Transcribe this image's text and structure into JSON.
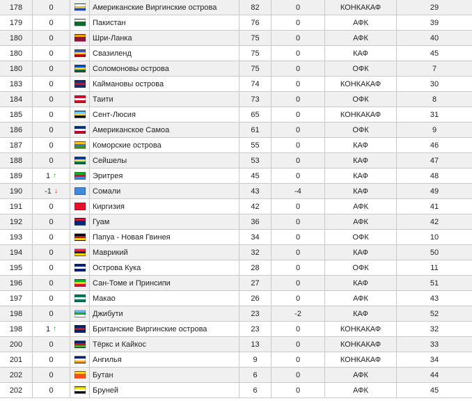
{
  "rows": [
    {
      "rank": "178",
      "change": "0",
      "arrow": "",
      "name": "Американские Виргинские острова",
      "points": "82",
      "diff": "0",
      "conf": "КОНКАКАФ",
      "conf_rank": "29",
      "flag_colors": [
        "#ffffff",
        "#d8c23a",
        "#1e4ca1"
      ]
    },
    {
      "rank": "179",
      "change": "0",
      "arrow": "",
      "name": "Пакистан",
      "points": "76",
      "diff": "0",
      "conf": "АФК",
      "conf_rank": "39",
      "flag_colors": [
        "#ffffff",
        "#0a6b2c",
        "#0a6b2c"
      ]
    },
    {
      "rank": "180",
      "change": "0",
      "arrow": "",
      "name": "Шри-Ланка",
      "points": "75",
      "diff": "0",
      "conf": "АФК",
      "conf_rank": "40",
      "flag_colors": [
        "#f4a300",
        "#8d153a",
        "#8d153a"
      ]
    },
    {
      "rank": "180",
      "change": "0",
      "arrow": "",
      "name": "Свазиленд",
      "points": "75",
      "diff": "0",
      "conf": "КАФ",
      "conf_rank": "45",
      "flag_colors": [
        "#3e5eb9",
        "#ffd900",
        "#b10c0c"
      ]
    },
    {
      "rank": "180",
      "change": "0",
      "arrow": "",
      "name": "Соломоновы острова",
      "points": "75",
      "diff": "0",
      "conf": "ОФК",
      "conf_rank": "7",
      "flag_colors": [
        "#0051ba",
        "#fcd116",
        "#215b33"
      ]
    },
    {
      "rank": "183",
      "change": "0",
      "arrow": "",
      "name": "Каймановы острова",
      "points": "74",
      "diff": "0",
      "conf": "КОНКАКАФ",
      "conf_rank": "30",
      "flag_colors": [
        "#1b2d6b",
        "#c8102e",
        "#1b2d6b"
      ]
    },
    {
      "rank": "184",
      "change": "0",
      "arrow": "",
      "name": "Таити",
      "points": "73",
      "diff": "0",
      "conf": "ОФК",
      "conf_rank": "8",
      "flag_colors": [
        "#ce1126",
        "#ffffff",
        "#ce1126"
      ]
    },
    {
      "rank": "185",
      "change": "0",
      "arrow": "",
      "name": "Сент-Люсия",
      "points": "65",
      "diff": "0",
      "conf": "КОНКАКАФ",
      "conf_rank": "31",
      "flag_colors": [
        "#66ccff",
        "#fcd116",
        "#000000"
      ]
    },
    {
      "rank": "186",
      "change": "0",
      "arrow": "",
      "name": "Американское Самоа",
      "points": "61",
      "diff": "0",
      "conf": "ОФК",
      "conf_rank": "9",
      "flag_colors": [
        "#002b7f",
        "#ffffff",
        "#bf0a30"
      ]
    },
    {
      "rank": "187",
      "change": "0",
      "arrow": "",
      "name": "Коморские острова",
      "points": "55",
      "diff": "0",
      "conf": "КАФ",
      "conf_rank": "46",
      "flag_colors": [
        "#ffc61e",
        "#3a75c4",
        "#3d8e33"
      ]
    },
    {
      "rank": "188",
      "change": "0",
      "arrow": "",
      "name": "Сейшелы",
      "points": "53",
      "diff": "0",
      "conf": "КАФ",
      "conf_rank": "47",
      "flag_colors": [
        "#003f87",
        "#fcd856",
        "#007a3d"
      ]
    },
    {
      "rank": "189",
      "change": "1",
      "arrow": "up",
      "name": "Эритрея",
      "points": "45",
      "diff": "0",
      "conf": "КАФ",
      "conf_rank": "48",
      "flag_colors": [
        "#12ad2b",
        "#ea0437",
        "#4189dd"
      ]
    },
    {
      "rank": "190",
      "change": "-1",
      "arrow": "down",
      "name": "Сомали",
      "points": "43",
      "diff": "-4",
      "conf": "КАФ",
      "conf_rank": "49",
      "flag_colors": [
        "#4189dd",
        "#4189dd",
        "#4189dd"
      ]
    },
    {
      "rank": "191",
      "change": "0",
      "arrow": "",
      "name": "Киргизия",
      "points": "42",
      "diff": "0",
      "conf": "АФК",
      "conf_rank": "41",
      "flag_colors": [
        "#e8112d",
        "#e8112d",
        "#e8112d"
      ]
    },
    {
      "rank": "192",
      "change": "0",
      "arrow": "",
      "name": "Гуам",
      "points": "36",
      "diff": "0",
      "conf": "АФК",
      "conf_rank": "42",
      "flag_colors": [
        "#c62139",
        "#00297b",
        "#00297b"
      ]
    },
    {
      "rank": "193",
      "change": "0",
      "arrow": "",
      "name": "Папуа - Новая Гвинея",
      "points": "34",
      "diff": "0",
      "conf": "ОФК",
      "conf_rank": "10",
      "flag_colors": [
        "#000000",
        "#ce1126",
        "#fcd116"
      ]
    },
    {
      "rank": "194",
      "change": "0",
      "arrow": "",
      "name": "Маврикий",
      "points": "32",
      "diff": "0",
      "conf": "КАФ",
      "conf_rank": "50",
      "flag_colors": [
        "#ea2839",
        "#1a206d",
        "#ffd500"
      ]
    },
    {
      "rank": "195",
      "change": "0",
      "arrow": "",
      "name": "Острова Кука",
      "points": "28",
      "diff": "0",
      "conf": "ОФК",
      "conf_rank": "11",
      "flag_colors": [
        "#00247d",
        "#ffffff",
        "#00247d"
      ]
    },
    {
      "rank": "196",
      "change": "0",
      "arrow": "",
      "name": "Сан-Томе и Принсипи",
      "points": "27",
      "diff": "0",
      "conf": "КАФ",
      "conf_rank": "51",
      "flag_colors": [
        "#12ad2b",
        "#ffce00",
        "#d21034"
      ]
    },
    {
      "rank": "197",
      "change": "0",
      "arrow": "",
      "name": "Макао",
      "points": "26",
      "diff": "0",
      "conf": "АФК",
      "conf_rank": "43",
      "flag_colors": [
        "#00785e",
        "#ffffff",
        "#00785e"
      ]
    },
    {
      "rank": "198",
      "change": "0",
      "arrow": "",
      "name": "Джибути",
      "points": "23",
      "diff": "-2",
      "conf": "КАФ",
      "conf_rank": "52",
      "flag_colors": [
        "#6ab2e7",
        "#12ad2b",
        "#ffffff"
      ]
    },
    {
      "rank": "198",
      "change": "1",
      "arrow": "up",
      "name": "Британские Виргинские острова",
      "points": "23",
      "diff": "0",
      "conf": "КОНКАКАФ",
      "conf_rank": "32",
      "flag_colors": [
        "#012169",
        "#c8102e",
        "#012169"
      ]
    },
    {
      "rank": "200",
      "change": "0",
      "arrow": "",
      "name": "Тёркс и Кайкос",
      "points": "13",
      "diff": "0",
      "conf": "КОНКАКАФ",
      "conf_rank": "33",
      "flag_colors": [
        "#012169",
        "#c8102e",
        "#4fa83a"
      ]
    },
    {
      "rank": "201",
      "change": "0",
      "arrow": "",
      "name": "Ангилья",
      "points": "9",
      "diff": "0",
      "conf": "КОНКАКАФ",
      "conf_rank": "34",
      "flag_colors": [
        "#012169",
        "#ffffff",
        "#f7a21b"
      ]
    },
    {
      "rank": "202",
      "change": "0",
      "arrow": "",
      "name": "Бутан",
      "points": "6",
      "diff": "0",
      "conf": "АФК",
      "conf_rank": "44",
      "flag_colors": [
        "#ffd520",
        "#ff4e12",
        "#ff4e12"
      ]
    },
    {
      "rank": "202",
      "change": "0",
      "arrow": "",
      "name": "Бруней",
      "points": "6",
      "diff": "0",
      "conf": "АФК",
      "conf_rank": "45",
      "flag_colors": [
        "#f7e017",
        "#ffffff",
        "#000000"
      ]
    }
  ],
  "arrows": {
    "up": "↑",
    "down": "↓"
  }
}
